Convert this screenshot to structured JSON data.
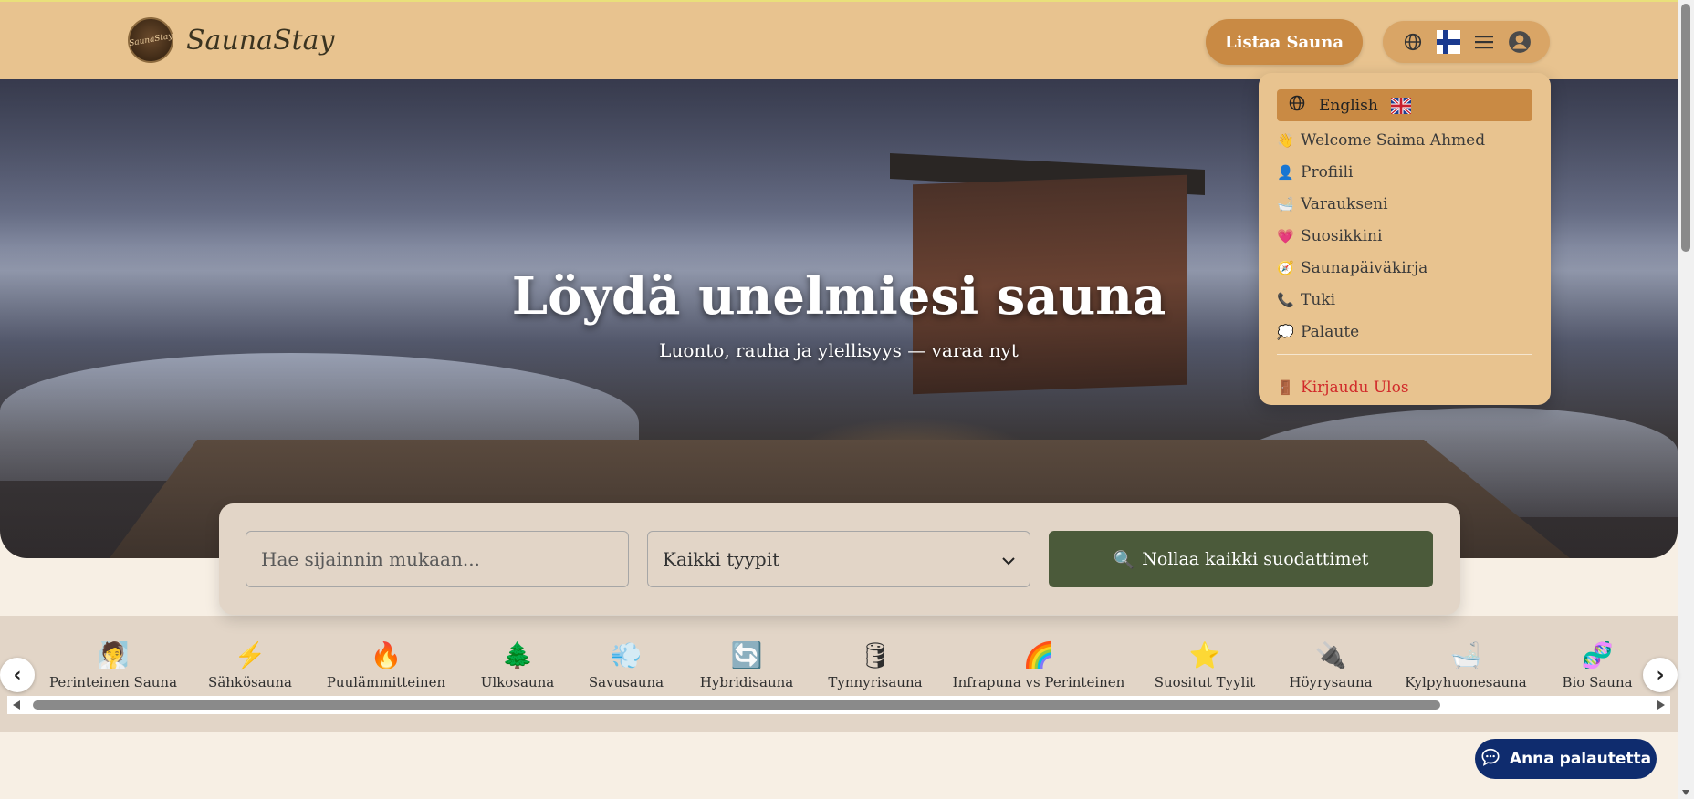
{
  "header": {
    "brand": "SaunaStay",
    "list_button": "Listaa Sauna"
  },
  "hero": {
    "title": "Löydä unelmiesi sauna",
    "subtitle": "Luonto, rauha ja ylellisyys — varaa nyt"
  },
  "search": {
    "placeholder": "Hae sijainnin mukaan...",
    "type_selected": "Kaikki tyypit",
    "reset_label": "Nollaa kaikki suodattimet",
    "reset_icon": "🔍"
  },
  "categories": [
    {
      "emoji": "🧖",
      "label": "Perinteinen Sauna"
    },
    {
      "emoji": "⚡",
      "label": "Sähkösauna"
    },
    {
      "emoji": "🔥",
      "label": "Puulämmitteinen"
    },
    {
      "emoji": "🌲",
      "label": "Ulkosauna"
    },
    {
      "emoji": "💨",
      "label": "Savusauna"
    },
    {
      "emoji": "🔄",
      "label": "Hybridisauna"
    },
    {
      "emoji": "🛢",
      "label": "Tynnyrisauna"
    },
    {
      "emoji": "🌈",
      "label": "Infrapuna vs Perinteinen"
    },
    {
      "emoji": "⭐",
      "label": "Suositut Tyylit"
    },
    {
      "emoji": "🔌",
      "label": "Höyrysauna"
    },
    {
      "emoji": "🛁",
      "label": "Kylpyhuonesauna"
    },
    {
      "emoji": "🧬",
      "label": "Bio Sauna"
    }
  ],
  "menu": {
    "language": "English",
    "items": [
      {
        "emoji": "👋",
        "label": "Welcome Saima Ahmed"
      },
      {
        "emoji": "👤",
        "label": "Profiili"
      },
      {
        "emoji": "🛁",
        "label": "Varaukseni"
      },
      {
        "emoji": "💗",
        "label": "Suosikkini"
      },
      {
        "emoji": "🧭",
        "label": "Saunapäiväkirja"
      },
      {
        "emoji": "📞",
        "label": "Tuki"
      },
      {
        "emoji": "💭",
        "label": "Palaute"
      }
    ],
    "logout": {
      "emoji": "🚪",
      "label": "Kirjaudu Ulos"
    }
  },
  "feedback": {
    "label": "Anna palautetta"
  },
  "colors": {
    "header": "#e8c38f",
    "accent": "#c98a44",
    "reset_button": "#4b5a3a",
    "feedback_button": "#0f2c6e",
    "logout": "#d12b2b"
  }
}
